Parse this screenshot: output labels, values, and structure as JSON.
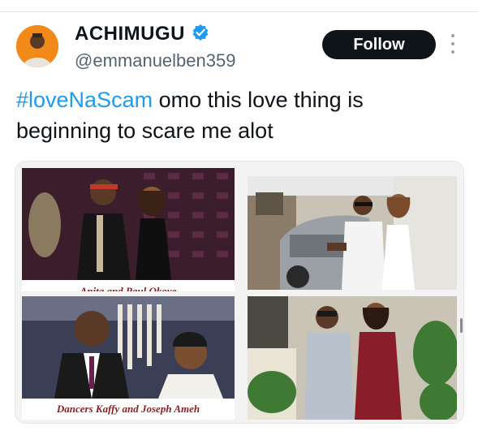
{
  "tweet": {
    "author": {
      "display_name": "ACHIMUGU",
      "handle": "@emmanuelben359",
      "verified_icon": "verified-badge-icon",
      "verified_color": "#1d9bf0"
    },
    "follow_label": "Follow",
    "text": {
      "hashtag": "#loveNaScam",
      "body": " omo this love thing is beginning to scare me alot"
    },
    "media": {
      "captions": {
        "top_left": "Anita and Paul Okoye",
        "bottom_left": "Dancers Kaffy and Joseph Ameh"
      }
    }
  },
  "colors": {
    "hashtag": "#1d9bf0",
    "follow_bg": "#0f1419",
    "caption": "#8a1f1f"
  }
}
